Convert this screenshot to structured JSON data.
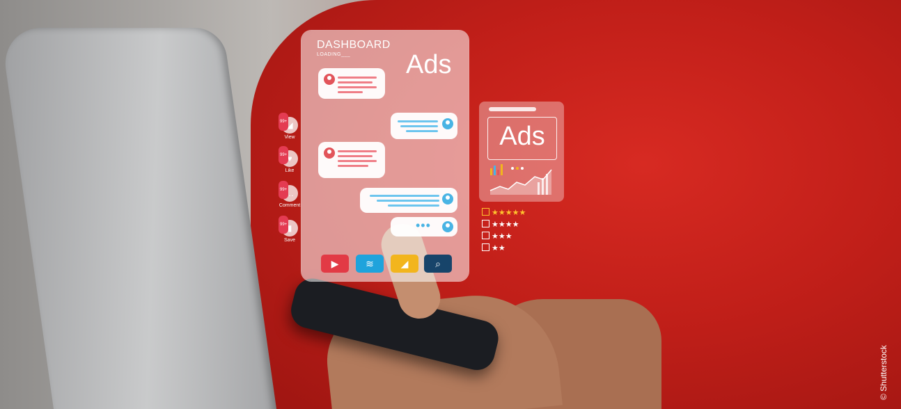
{
  "dashboard": {
    "title": "DASHBOARD",
    "subtitle": "LOADING___",
    "ads_label": "Ads",
    "messages": [
      {
        "side": "left",
        "avatar_color": "#e2545a"
      },
      {
        "side": "right",
        "avatar_color": "#49b4e4"
      },
      {
        "side": "left",
        "avatar_color": "#e2545a"
      },
      {
        "side": "right",
        "avatar_color": "#49b4e4"
      },
      {
        "side": "right",
        "avatar_color": "#49b4e4",
        "typing": "•••"
      }
    ],
    "toolbar": [
      {
        "icon": "play-icon",
        "glyph": "▶",
        "color": "#e23a45"
      },
      {
        "icon": "wifi-icon",
        "glyph": "≋",
        "color": "#1fa3dc"
      },
      {
        "icon": "megaphone-icon",
        "glyph": "◢",
        "color": "#f2b51d"
      },
      {
        "icon": "search-icon",
        "glyph": "⌕",
        "color": "#17446a"
      }
    ]
  },
  "reactions": [
    {
      "icon": "megaphone-icon",
      "glyph": "◢",
      "badge": "99+",
      "label": "View"
    },
    {
      "icon": "heart-icon",
      "glyph": "♥",
      "badge": "99+",
      "label": "Like"
    },
    {
      "icon": "comment-icon",
      "glyph": "…",
      "badge": "99+",
      "label": "Comment"
    },
    {
      "icon": "bookmark-icon",
      "glyph": "▮",
      "badge": "99+",
      "label": "Save"
    }
  ],
  "ad_card": {
    "label": "Ads"
  },
  "ratings": [
    {
      "stars": "★★★★★",
      "checked": true
    },
    {
      "stars": "★★★★",
      "checked": false
    },
    {
      "stars": "★★★",
      "checked": false
    },
    {
      "stars": "★★",
      "checked": false
    }
  ],
  "credit": "© Shutterstock",
  "colors": {
    "sweater": "#c9261f",
    "accent_red": "#e23a45",
    "accent_blue": "#1fa3dc",
    "star_gold": "#ffc42e"
  }
}
